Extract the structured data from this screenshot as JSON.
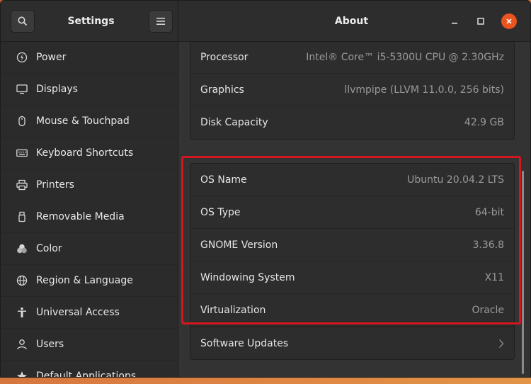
{
  "header": {
    "left_title": "Settings",
    "right_title": "About"
  },
  "sidebar": {
    "items": [
      {
        "label": "Power",
        "icon": "power-icon"
      },
      {
        "label": "Displays",
        "icon": "display-icon"
      },
      {
        "label": "Mouse & Touchpad",
        "icon": "mouse-icon"
      },
      {
        "label": "Keyboard Shortcuts",
        "icon": "keyboard-icon"
      },
      {
        "label": "Printers",
        "icon": "printer-icon"
      },
      {
        "label": "Removable Media",
        "icon": "usb-icon"
      },
      {
        "label": "Color",
        "icon": "color-icon"
      },
      {
        "label": "Region & Language",
        "icon": "globe-icon"
      },
      {
        "label": "Universal Access",
        "icon": "accessibility-icon"
      },
      {
        "label": "Users",
        "icon": "users-icon"
      },
      {
        "label": "Default Applications",
        "icon": "star-icon"
      }
    ]
  },
  "hardware": [
    {
      "label": "Processor",
      "value": "Intel® Core™ i5-5300U CPU @ 2.30GHz"
    },
    {
      "label": "Graphics",
      "value": "llvmpipe (LLVM 11.0.0, 256 bits)"
    },
    {
      "label": "Disk Capacity",
      "value": "42.9 GB"
    }
  ],
  "os": [
    {
      "label": "OS Name",
      "value": "Ubuntu 20.04.2 LTS"
    },
    {
      "label": "OS Type",
      "value": "64-bit"
    },
    {
      "label": "GNOME Version",
      "value": "3.36.8"
    },
    {
      "label": "Windowing System",
      "value": "X11"
    },
    {
      "label": "Virtualization",
      "value": "Oracle"
    }
  ],
  "updates": {
    "label": "Software Updates"
  },
  "colors": {
    "accent": "#e95420",
    "highlight": "#d4161f"
  }
}
